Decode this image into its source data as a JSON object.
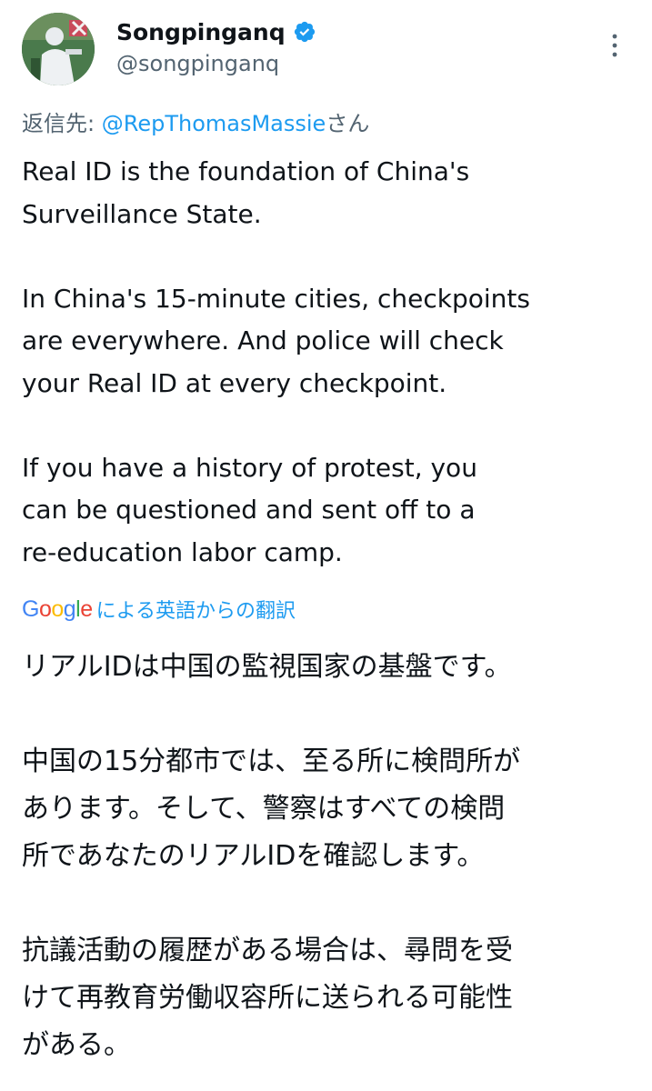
{
  "author": {
    "display_name": "Songpinganq",
    "handle": "@songpinganq"
  },
  "reply": {
    "prefix": "返信先: ",
    "mention": "@RepThomasMassie",
    "suffix": "さん"
  },
  "tweet": {
    "text": "Real ID is the foundation of China's\nSurveillance State.\n\nIn China's 15-minute cities, checkpoints\nare everywhere. And police will check\nyour Real ID at every checkpoint.\n\nIf you have a history of protest, you\ncan be questioned and sent off to a\nre-education labor camp."
  },
  "translation": {
    "provider": "Google",
    "label": "による英語からの翻訳",
    "text": "リアルIDは中国の監視国家の基盤です。\n\n中国の15分都市では、至る所に検問所が\nあります。そして、警察はすべての検問\n所であなたのリアルIDを確認します。\n\n抗議活動の履歴がある場合は、尋問を受\nけて再教育労働収容所に送られる可能性\nがある。"
  },
  "icons": {
    "verified": "verified-badge-icon",
    "more": "more-options-icon"
  },
  "colors": {
    "accent": "#1d9bf0",
    "text": "#0f1419",
    "secondary": "#536471"
  }
}
